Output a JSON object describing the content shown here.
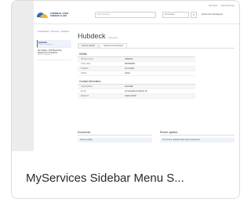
{
  "card": {
    "caption": "MyServices Sidebar Menu S..."
  },
  "screenshot": {
    "toplinks": [
      "Services",
      "Self Services"
    ],
    "logo_text": "CORNWALL STEM SCIENCE CLASS",
    "search_placeholder": "Find Anything",
    "select_value": "All Content",
    "user_label": "MyServices Workspace",
    "breadcrumb": "< Dashboard > Services > Hubdeck",
    "sidebar": [
      {
        "label": "Hubdeck",
        "sub": "Service navigation"
      },
      {
        "label": "Get Status, Self Reporting, Department Guidance",
        "sub": "Browse categories"
      }
    ],
    "page_title": "Hubdeck",
    "page_title_small": "Categories",
    "tabs": [
      "Service details",
      "Departmental Support"
    ],
    "details_title": "Details",
    "details_rows": [
      {
        "k": "Service name",
        "v": "Hubdeck"
      },
      {
        "k": "Order date",
        "v": "28/10/2020"
      },
      {
        "k": "Duration",
        "v": "12 months"
      },
      {
        "k": "Status",
        "v": "Active"
      }
    ],
    "contact_title": "Contact information",
    "contact_rows": [
      {
        "k": "Organisation",
        "v": "Cornwall"
      },
      {
        "k": "Email",
        "v": "services@cornwall.ac.uk"
      },
      {
        "k": "Relevant",
        "v": "Lead contact"
      }
    ],
    "bottom_left_title": "Documents",
    "bottom_left_row": "Service guide",
    "bottom_right_title": "Recent updates",
    "bottom_right_row": "No service updates have been posted yet"
  }
}
